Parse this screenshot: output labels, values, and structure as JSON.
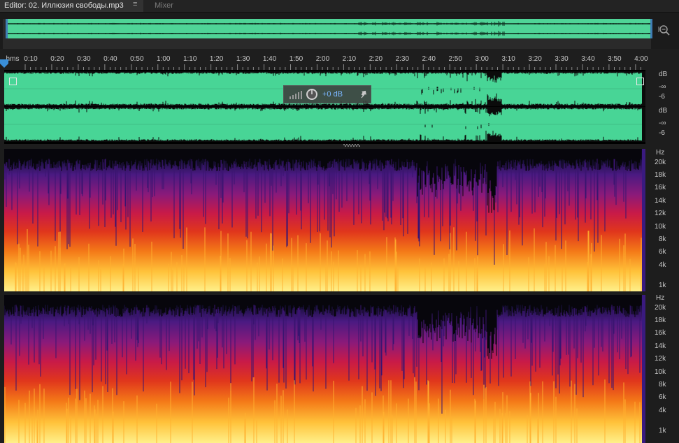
{
  "tabs": {
    "editor_title": "Editor: 02. Иллюзия свободы.mp3",
    "menu_glyph": "≡",
    "mixer_label": "Mixer"
  },
  "overview": {
    "zoom_icon": "zoom-fit-icon"
  },
  "timeline": {
    "unit_label": "hms",
    "ticks": [
      "0:10",
      "0:20",
      "0:30",
      "0:40",
      "0:50",
      "1:00",
      "1:10",
      "1:20",
      "1:30",
      "1:40",
      "1:50",
      "2:00",
      "2:10",
      "2:20",
      "2:30",
      "2:40",
      "2:50",
      "3:00",
      "3:10",
      "3:20",
      "3:30",
      "3:40",
      "3:50",
      "4:00"
    ],
    "playhead_icon": "playhead-marker-icon",
    "monitor_icon": "headphones-icon"
  },
  "waveform": {
    "color": "#48d596",
    "hud_gain": "+0 dB",
    "hud_icons": [
      "level-meter-icon",
      "gain-knob-icon",
      "pin-icon"
    ],
    "left_scale": {
      "unit": "dB",
      "a": "-∞",
      "b": "-6"
    },
    "right_scale": {
      "unit": "dB",
      "a": "-∞",
      "b": "-6"
    }
  },
  "spectral": {
    "left_scale": {
      "unit": "Hz",
      "labels": [
        "20k",
        "18k",
        "16k",
        "14k",
        "12k",
        "10k",
        "8k",
        "6k",
        "4k",
        "1k"
      ]
    },
    "right_scale": {
      "unit": "Hz",
      "labels": [
        "20k",
        "18k",
        "16k",
        "14k",
        "12k",
        "10k",
        "8k",
        "6k",
        "4k",
        "1k"
      ]
    },
    "colors": [
      "#0a0a14",
      "#3a1a78",
      "#7a1a8a",
      "#c01860",
      "#e8341a",
      "#f88a18",
      "#ffd84a",
      "#fff6a0"
    ]
  }
}
